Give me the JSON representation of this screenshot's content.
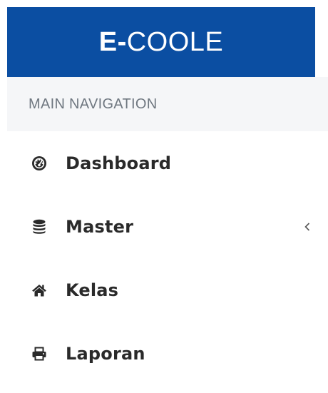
{
  "brand": {
    "title_bold": "E-",
    "title_rest": "COOLE",
    "background_color": "#0b4ea2"
  },
  "navigation": {
    "header": "MAIN NAVIGATION",
    "items": [
      {
        "label": "Dashboard",
        "icon": "dashboard-gauge-icon"
      },
      {
        "label": "Master",
        "icon": "database-icon",
        "has_submenu": true,
        "submenu_icon": "chevron-left-icon"
      },
      {
        "label": "Kelas",
        "icon": "home-icon"
      },
      {
        "label": "Laporan",
        "icon": "print-icon"
      }
    ]
  }
}
